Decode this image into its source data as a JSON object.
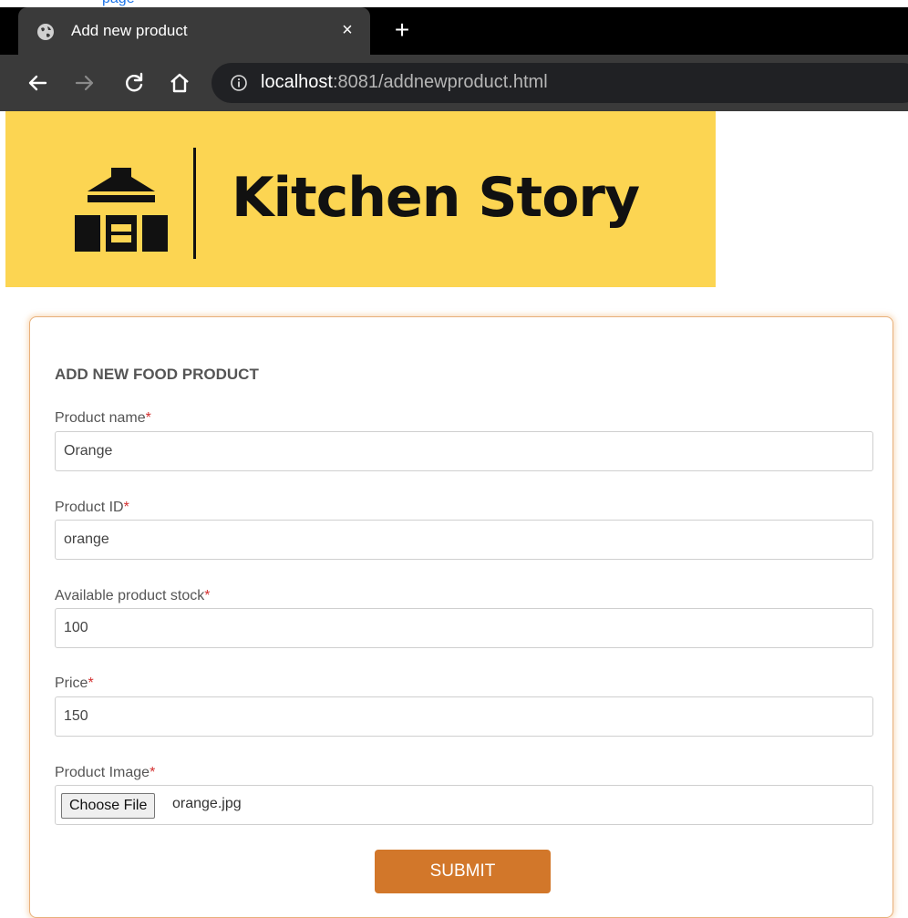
{
  "browser": {
    "top_sliver_text": "page",
    "tab_title": "Add new product",
    "close_glyph": "×",
    "new_tab_glyph": "+",
    "url_host": "localhost",
    "url_rest": ":8081/addnewproduct.html"
  },
  "banner": {
    "brand": "Kitchen Story",
    "background": "#fcd552"
  },
  "form": {
    "title": "ADD NEW FOOD PRODUCT",
    "required_mark": "*",
    "fields": [
      {
        "label": "Product name",
        "value": "Orange"
      },
      {
        "label": "Product ID",
        "value": "orange"
      },
      {
        "label": "Available product stock",
        "value": "100"
      },
      {
        "label": "Price",
        "value": "150"
      }
    ],
    "image": {
      "label": "Product Image",
      "button": "Choose File",
      "file_name": "orange.jpg"
    },
    "submit_label": "SUBMIT",
    "accent": "#d2772a"
  }
}
